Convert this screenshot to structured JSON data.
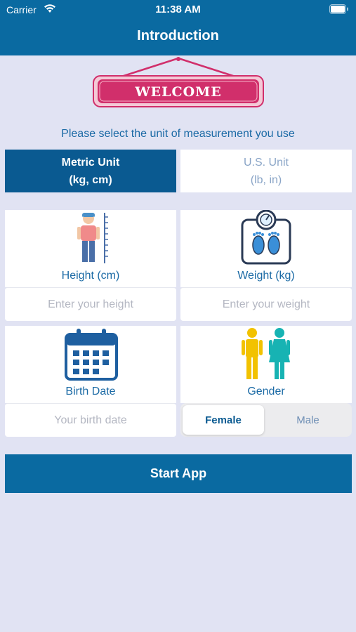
{
  "status_bar": {
    "carrier": "Carrier",
    "time": "11:38 AM"
  },
  "nav": {
    "title": "Introduction"
  },
  "welcome": {
    "text": "WELCOME"
  },
  "unit_prompt": "Please select the unit of measurement you use",
  "units": {
    "metric": {
      "title": "Metric Unit",
      "sub": "(kg, cm)",
      "selected": true
    },
    "us": {
      "title": "U.S. Unit",
      "sub": "(lb, in)",
      "selected": false
    }
  },
  "height": {
    "label": "Height (cm)",
    "placeholder": "Enter your height"
  },
  "weight": {
    "label": "Weight (kg)",
    "placeholder": "Enter your weight"
  },
  "birth": {
    "label": "Birth Date",
    "placeholder": "Your birth date"
  },
  "gender": {
    "label": "Gender",
    "female": "Female",
    "male": "Male",
    "selected": "Female"
  },
  "start_button": "Start App",
  "colors": {
    "brand": "#0a6aa1",
    "background": "#e1e3f3",
    "accent_text": "#1b6aa5",
    "welcome_pink": "#d12f6b"
  },
  "icons": [
    "wifi-icon",
    "battery-icon",
    "welcome-sign-icon",
    "height-person-icon",
    "scale-icon",
    "calendar-icon",
    "gender-icon"
  ]
}
